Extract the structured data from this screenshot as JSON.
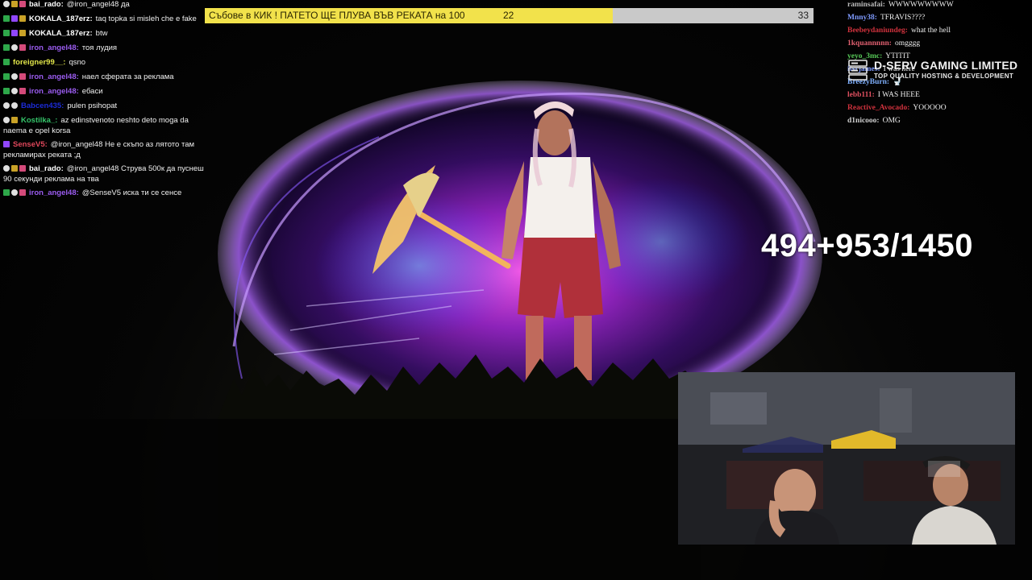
{
  "poll": {
    "question": "Събове в КИК ! ПАТЕТО ЩЕ ПЛУВА ВЪВ РЕКАТА на 100",
    "yes_count": "22",
    "no_count": "33",
    "yes_share": 0.67,
    "fill_color": "#f2e24b",
    "track_color": "#c9c9c9"
  },
  "counter": {
    "text": "494+953/1450"
  },
  "sponsor": {
    "name": "D-SERV GAMING LIMITED",
    "tagline": "TOP QUALITY HOSTING & DEVELOPMENT",
    "icon": "server-rack-icon"
  },
  "chat_left": [
    {
      "badges": [
        "vip",
        "bits",
        "gift"
      ],
      "user": "bai_rado:",
      "color": "#ffffff",
      "text": "@iron_angel48 да"
    },
    {
      "badges": [
        "mod",
        "sub",
        "bits"
      ],
      "user": "KOKALA_187erz:",
      "color": "#ffffff",
      "text": "taq topka si misleh che e fake"
    },
    {
      "badges": [
        "mod",
        "sub",
        "bits"
      ],
      "user": "KOKALA_187erz:",
      "color": "#ffffff",
      "text": "btw"
    },
    {
      "badges": [
        "mod",
        "vip",
        "gift"
      ],
      "user": "iron_angel48:",
      "color": "#9b5cf0",
      "text": "тоя лудия"
    },
    {
      "badges": [
        "mod"
      ],
      "user": "foreigner99__:",
      "color": "#e2e64a",
      "text": "qsno"
    },
    {
      "badges": [
        "mod",
        "vip",
        "gift"
      ],
      "user": "iron_angel48:",
      "color": "#9b5cf0",
      "text": "наел сферата за реклама"
    },
    {
      "badges": [
        "mod",
        "vip",
        "gift"
      ],
      "user": "iron_angel48:",
      "color": "#9b5cf0",
      "text": "ебаси"
    },
    {
      "badges": [
        "vip",
        "vip"
      ],
      "user": "Babcen435:",
      "color": "#1c2cd8",
      "text": "pulen psihopat"
    },
    {
      "badges": [
        "vip",
        "bits"
      ],
      "user": "Kostilka_:",
      "color": "#35c46a",
      "text": "az edinstvenoto neshto deto moga da naema e opel korsa"
    },
    {
      "badges": [
        "sub"
      ],
      "user": "SenseV5:",
      "color": "#e0475b",
      "text": "@iron_angel48 Не е скъпо аз лятото там рекламирах реката ;д"
    },
    {
      "badges": [
        "vip",
        "bits",
        "gift"
      ],
      "user": "bai_rado:",
      "color": "#ffffff",
      "text": "@iron_angel48 Струва 500к да пуснеш 90 секунди реклама на тва"
    },
    {
      "badges": [
        "mod",
        "vip",
        "gift"
      ],
      "user": "iron_angel48:",
      "color": "#9b5cf0",
      "text": "@SenseV5 иска ти се сенсе"
    }
  ],
  "chat_right": [
    {
      "user": "raminsafai:",
      "color": "#b9b9b9",
      "text": "WWWWWWWWW"
    },
    {
      "user": "Mnny38:",
      "color": "#7f9bff",
      "text": "TFRAVIS????"
    },
    {
      "user": "Beebeydaniundeg:",
      "color": "#d0323d",
      "text": "what the hell"
    },
    {
      "user": "1kquannnnn:",
      "color": "#e06070",
      "text": "omgggg"
    },
    {
      "user": "yeyo_3mc:",
      "color": "#56c857",
      "text": "YTITIT"
    },
    {
      "user": "itsrjames:",
      "color": "#7f9bff",
      "text": "I was here"
    },
    {
      "user": "BreezyBurn:",
      "color": "#7fb0ff",
      "text": "🚽"
    },
    {
      "user": "lebb111:",
      "color": "#e05060",
      "text": "I WAS HEEE"
    },
    {
      "user": "Reactive_Avocado:",
      "color": "#d0323d",
      "text": "YOOOOO"
    },
    {
      "user": "d1nicooo:",
      "color": "#d0d0d0",
      "text": "OMG"
    }
  ]
}
